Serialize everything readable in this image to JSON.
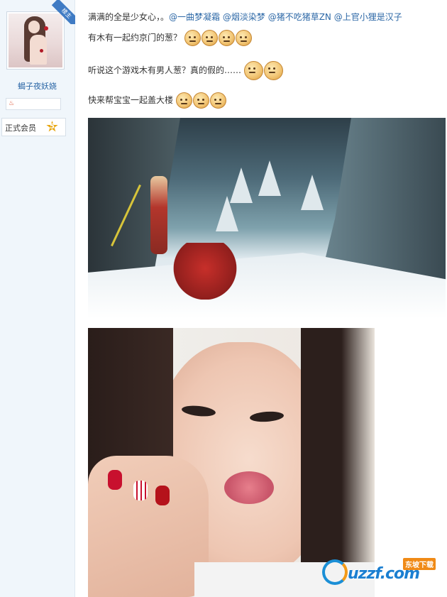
{
  "sidebar": {
    "badge": "楼主",
    "username": "蝎子夜妖娆",
    "member_label": "正式会员",
    "level": "5"
  },
  "post": {
    "line1": {
      "text": "满满的全是少女心，。",
      "mentions": [
        "@一曲梦凝霜",
        "@烟淡染梦",
        "@猪不吃猪草ZN",
        "@上官小狸是汉子"
      ]
    },
    "line2": "有木有一起约京门的葱？",
    "line3": "听说这个游戏木有男人葱？真的假的……",
    "line4": "快来帮宝宝一起盖大楼"
  },
  "watermark": {
    "brand": "uzzf.com",
    "tag": "东坡下载"
  }
}
